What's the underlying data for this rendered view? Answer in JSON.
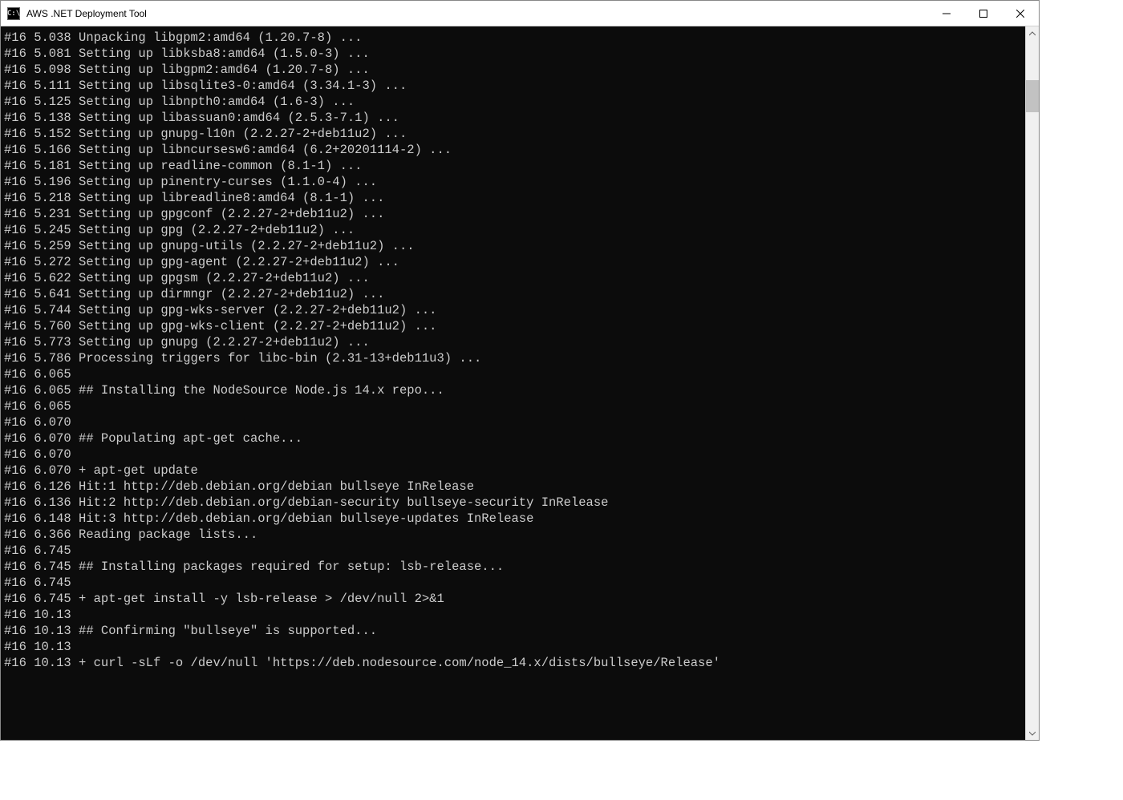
{
  "window": {
    "title": "AWS .NET Deployment Tool",
    "icon_label": "C:\\"
  },
  "console": {
    "lines": [
      "#16 5.038 Unpacking libgpm2:amd64 (1.20.7-8) ...",
      "#16 5.081 Setting up libksba8:amd64 (1.5.0-3) ...",
      "#16 5.098 Setting up libgpm2:amd64 (1.20.7-8) ...",
      "#16 5.111 Setting up libsqlite3-0:amd64 (3.34.1-3) ...",
      "#16 5.125 Setting up libnpth0:amd64 (1.6-3) ...",
      "#16 5.138 Setting up libassuan0:amd64 (2.5.3-7.1) ...",
      "#16 5.152 Setting up gnupg-l10n (2.2.27-2+deb11u2) ...",
      "#16 5.166 Setting up libncursesw6:amd64 (6.2+20201114-2) ...",
      "#16 5.181 Setting up readline-common (8.1-1) ...",
      "#16 5.196 Setting up pinentry-curses (1.1.0-4) ...",
      "#16 5.218 Setting up libreadline8:amd64 (8.1-1) ...",
      "#16 5.231 Setting up gpgconf (2.2.27-2+deb11u2) ...",
      "#16 5.245 Setting up gpg (2.2.27-2+deb11u2) ...",
      "#16 5.259 Setting up gnupg-utils (2.2.27-2+deb11u2) ...",
      "#16 5.272 Setting up gpg-agent (2.2.27-2+deb11u2) ...",
      "#16 5.622 Setting up gpgsm (2.2.27-2+deb11u2) ...",
      "#16 5.641 Setting up dirmngr (2.2.27-2+deb11u2) ...",
      "#16 5.744 Setting up gpg-wks-server (2.2.27-2+deb11u2) ...",
      "#16 5.760 Setting up gpg-wks-client (2.2.27-2+deb11u2) ...",
      "#16 5.773 Setting up gnupg (2.2.27-2+deb11u2) ...",
      "#16 5.786 Processing triggers for libc-bin (2.31-13+deb11u3) ...",
      "#16 6.065",
      "#16 6.065 ## Installing the NodeSource Node.js 14.x repo...",
      "#16 6.065",
      "#16 6.070",
      "#16 6.070 ## Populating apt-get cache...",
      "#16 6.070",
      "#16 6.070 + apt-get update",
      "#16 6.126 Hit:1 http://deb.debian.org/debian bullseye InRelease",
      "#16 6.136 Hit:2 http://deb.debian.org/debian-security bullseye-security InRelease",
      "#16 6.148 Hit:3 http://deb.debian.org/debian bullseye-updates InRelease",
      "#16 6.366 Reading package lists...",
      "#16 6.745",
      "#16 6.745 ## Installing packages required for setup: lsb-release...",
      "#16 6.745",
      "#16 6.745 + apt-get install -y lsb-release > /dev/null 2>&1",
      "#16 10.13",
      "#16 10.13 ## Confirming \"bullseye\" is supported...",
      "#16 10.13",
      "#16 10.13 + curl -sLf -o /dev/null 'https://deb.nodesource.com/node_14.x/dists/bullseye/Release'"
    ]
  }
}
